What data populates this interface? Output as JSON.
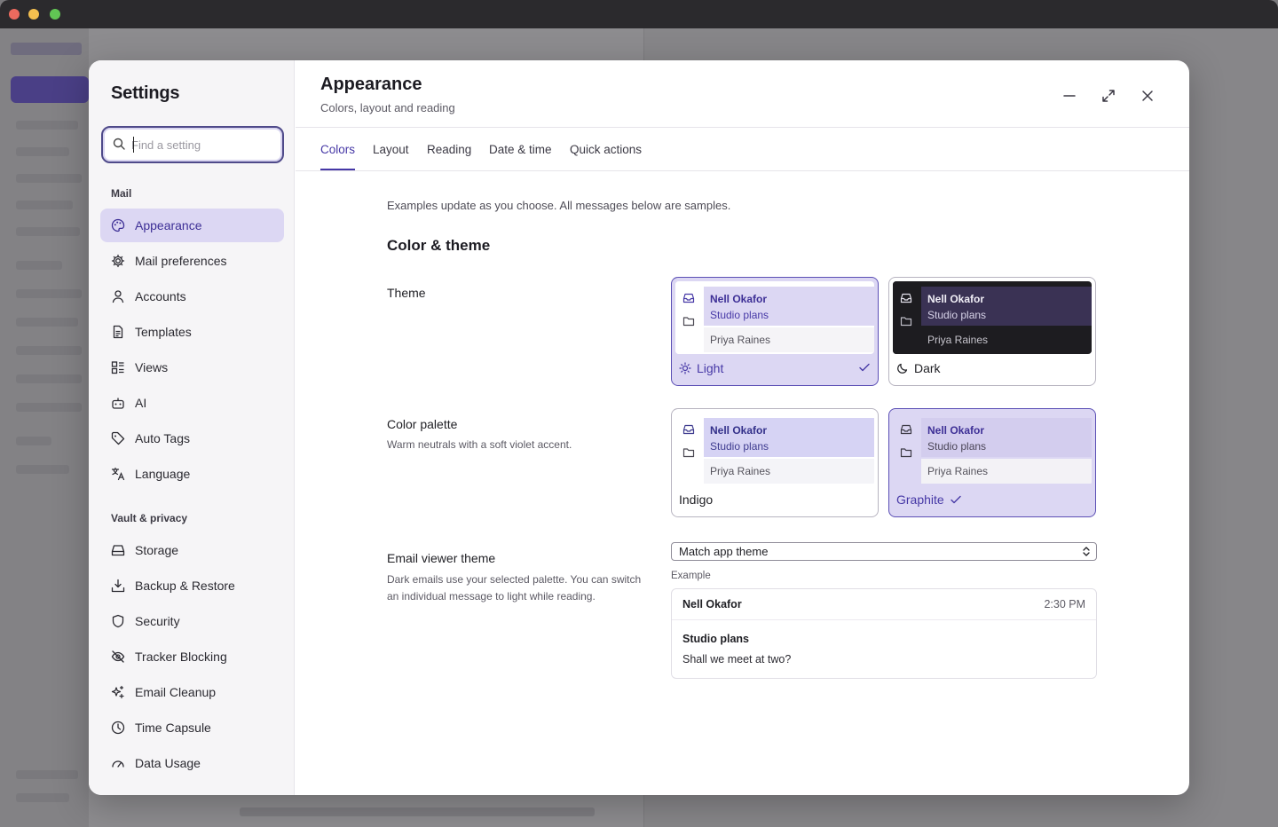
{
  "window": {
    "close_color": "#ed6a5e",
    "minimize_color": "#f4bf4f",
    "zoom_color": "#61c554"
  },
  "settings": {
    "title": "Settings",
    "search": {
      "placeholder": "Find a setting",
      "value": ""
    },
    "groups": [
      {
        "label": "Mail",
        "items": [
          {
            "label": "Appearance",
            "icon": "palette-icon",
            "active": true
          },
          {
            "label": "Mail preferences",
            "icon": "gear-icon"
          },
          {
            "label": "Accounts",
            "icon": "person-icon"
          },
          {
            "label": "Templates",
            "icon": "document-icon"
          },
          {
            "label": "Views",
            "icon": "views-icon"
          },
          {
            "label": "AI",
            "icon": "robot-icon"
          },
          {
            "label": "Auto Tags",
            "icon": "tag-icon"
          },
          {
            "label": "Language",
            "icon": "translate-icon"
          }
        ]
      },
      {
        "label": "Vault & privacy",
        "items": [
          {
            "label": "Storage",
            "icon": "storage-icon"
          },
          {
            "label": "Backup & Restore",
            "icon": "download-tray-icon"
          },
          {
            "label": "Security",
            "icon": "shield-icon"
          },
          {
            "label": "Tracker Blocking",
            "icon": "eye-off-icon"
          },
          {
            "label": "Email Cleanup",
            "icon": "sparkles-icon"
          },
          {
            "label": "Time Capsule",
            "icon": "clock-icon"
          },
          {
            "label": "Data Usage",
            "icon": "gauge-icon"
          }
        ]
      }
    ]
  },
  "header": {
    "title": "Appearance",
    "subtitle": "Colors, layout and reading",
    "controls": {
      "minimize": "minimize-icon",
      "expand": "expand-icon",
      "close": "close-icon"
    }
  },
  "tabs": [
    {
      "label": "Colors",
      "active": true
    },
    {
      "label": "Layout"
    },
    {
      "label": "Reading"
    },
    {
      "label": "Date & time"
    },
    {
      "label": "Quick actions"
    }
  ],
  "colors_page": {
    "intro": "Examples update as you choose. All messages below are samples.",
    "section_title": "Color & theme",
    "theme": {
      "label": "Theme",
      "options": [
        {
          "caption": "Light",
          "icon": "sun-icon",
          "selected": true,
          "preview": {
            "name": "Nell Okafor",
            "subject": "Studio plans",
            "other": "Priya Raines"
          }
        },
        {
          "caption": "Dark",
          "icon": "moon-icon",
          "selected": false,
          "preview": {
            "name": "Nell Okafor",
            "subject": "Studio plans",
            "other": "Priya Raines"
          }
        }
      ]
    },
    "palette": {
      "label": "Color palette",
      "description": "Warm neutrals with a soft violet accent.",
      "options": [
        {
          "caption": "Indigo",
          "selected": false,
          "preview": {
            "name": "Nell Okafor",
            "subject": "Studio plans",
            "other": "Priya Raines"
          }
        },
        {
          "caption": "Graphite",
          "selected": true,
          "preview": {
            "name": "Nell Okafor",
            "subject": "Studio plans",
            "other": "Priya Raines"
          }
        }
      ]
    },
    "email_viewer": {
      "label": "Email viewer theme",
      "description": "Dark emails use your selected palette. You can switch an individual message to light while reading.",
      "select_value": "Match app theme",
      "example_label": "Example",
      "example": {
        "from": "Nell Okafor",
        "time": "2:30 PM",
        "subject": "Studio plans",
        "body": "Shall we meet at two?"
      }
    }
  },
  "colors": {
    "accent": "#4638a6",
    "accent_light": "#dcd7f3",
    "dark_preview": "#1d1c20"
  }
}
